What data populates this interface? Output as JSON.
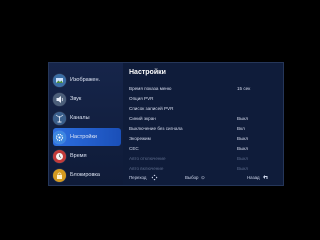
{
  "sidebar": {
    "items": [
      {
        "label": "Изображен.",
        "icon": "picture-icon",
        "color": "#3a6ea5"
      },
      {
        "label": "Звук",
        "icon": "speaker-icon",
        "color": "#4c5f7a"
      },
      {
        "label": "Каналы",
        "icon": "antenna-icon",
        "color": "#3a5f8c"
      },
      {
        "label": "Настройки",
        "icon": "settings-icon",
        "color": "#3c87e0",
        "active": true
      },
      {
        "label": "Время",
        "icon": "clock-icon",
        "color": "#c23a3a"
      },
      {
        "label": "Блокировка",
        "icon": "lock-icon",
        "color": "#d49a1e"
      }
    ]
  },
  "main": {
    "title": "Настройки",
    "rows": [
      {
        "label": "Время показа меню",
        "value": "15 сек"
      },
      {
        "label": "Опция PVR",
        "value": ""
      },
      {
        "label": "Список записей PVR",
        "value": ""
      },
      {
        "label": "Синий экран",
        "value": "Выкл"
      },
      {
        "label": "Выключение без сигнала",
        "value": "Вкл"
      },
      {
        "label": "Экорежим",
        "value": "Выкл"
      },
      {
        "label": "CEC",
        "value": "Выкл"
      },
      {
        "label": "Авто отключение",
        "value": "Выкл",
        "disabled": true
      },
      {
        "label": "Авто включение",
        "value": "Выкл",
        "disabled": true
      }
    ]
  },
  "footer": {
    "move_label": "Переход",
    "move_icon": "dpad-icon",
    "select_label": "Выбор",
    "select_icon": "ok-icon",
    "back_label": "Назад",
    "back_icon": "return-arrow-icon"
  },
  "colors": {
    "active": "#2d6fe0",
    "panel": "#0f1c3a"
  }
}
